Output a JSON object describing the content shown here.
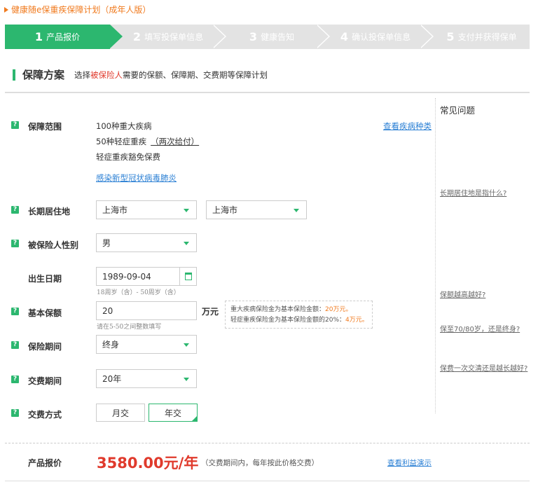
{
  "page": {
    "title": "健康随e保重疾保障计划（成年人版）"
  },
  "steps": [
    {
      "num": "1",
      "label": "产品报价"
    },
    {
      "num": "2",
      "label": "填写投保单信息"
    },
    {
      "num": "3",
      "label": "健康告知"
    },
    {
      "num": "4",
      "label": "确认投保单信息"
    },
    {
      "num": "5",
      "label": "支付并获得保单"
    }
  ],
  "section": {
    "heading": "保障方案",
    "desc_pre": "选择",
    "desc_highlight": "被保险人",
    "desc_post": "需要的保额、保障期、交费期等保障计划"
  },
  "coverage": {
    "label": "保障范围",
    "line1": "100种重大疾病",
    "line2": "50种轻症重疾",
    "line2_extra": "（两次给付）",
    "line3": "轻症重疾豁免保费",
    "covid_link": "感染新型冠状病毒肺炎",
    "disease_link": "查看疾病种类"
  },
  "residence": {
    "label": "长期居住地",
    "province": "上海市",
    "city": "上海市"
  },
  "gender": {
    "label": "被保险人性别",
    "value": "男"
  },
  "birth": {
    "label": "出生日期",
    "value": "1989-09-04",
    "hint": "18周岁（含）- 50周岁（含）"
  },
  "amount": {
    "label": "基本保额",
    "value": "20",
    "unit": "万元",
    "hint": "请在5-50之间整数填写",
    "note1_pre": "重大疾病保险金为基本保险金额：",
    "note1_val": "20万元。",
    "note2_pre": "轻症重疾保险金为基本保险金额的20%：",
    "note2_val": "4万元。"
  },
  "period": {
    "label": "保险期间",
    "value": "终身"
  },
  "pay_period": {
    "label": "交费期间",
    "value": "20年"
  },
  "pay_method": {
    "label": "交费方式",
    "monthly": "月交",
    "yearly": "年交"
  },
  "faq": {
    "heading": "常见问题",
    "q1": "长期居住地是指什么?",
    "q2": "保额越高越好?",
    "q3": "保至70/80岁，还是终身?",
    "q4": "保费一次交清还是越长越好?"
  },
  "quote": {
    "label": "产品报价",
    "price": "3580.00元/年",
    "note": "（交费期间内，每年按此价格交费）",
    "benefit_link": "查看利益演示"
  },
  "colors": {
    "accent": "#2cb76f",
    "orange": "#f07a1e",
    "red": "#e03a2c",
    "link": "#2a7fd4"
  }
}
